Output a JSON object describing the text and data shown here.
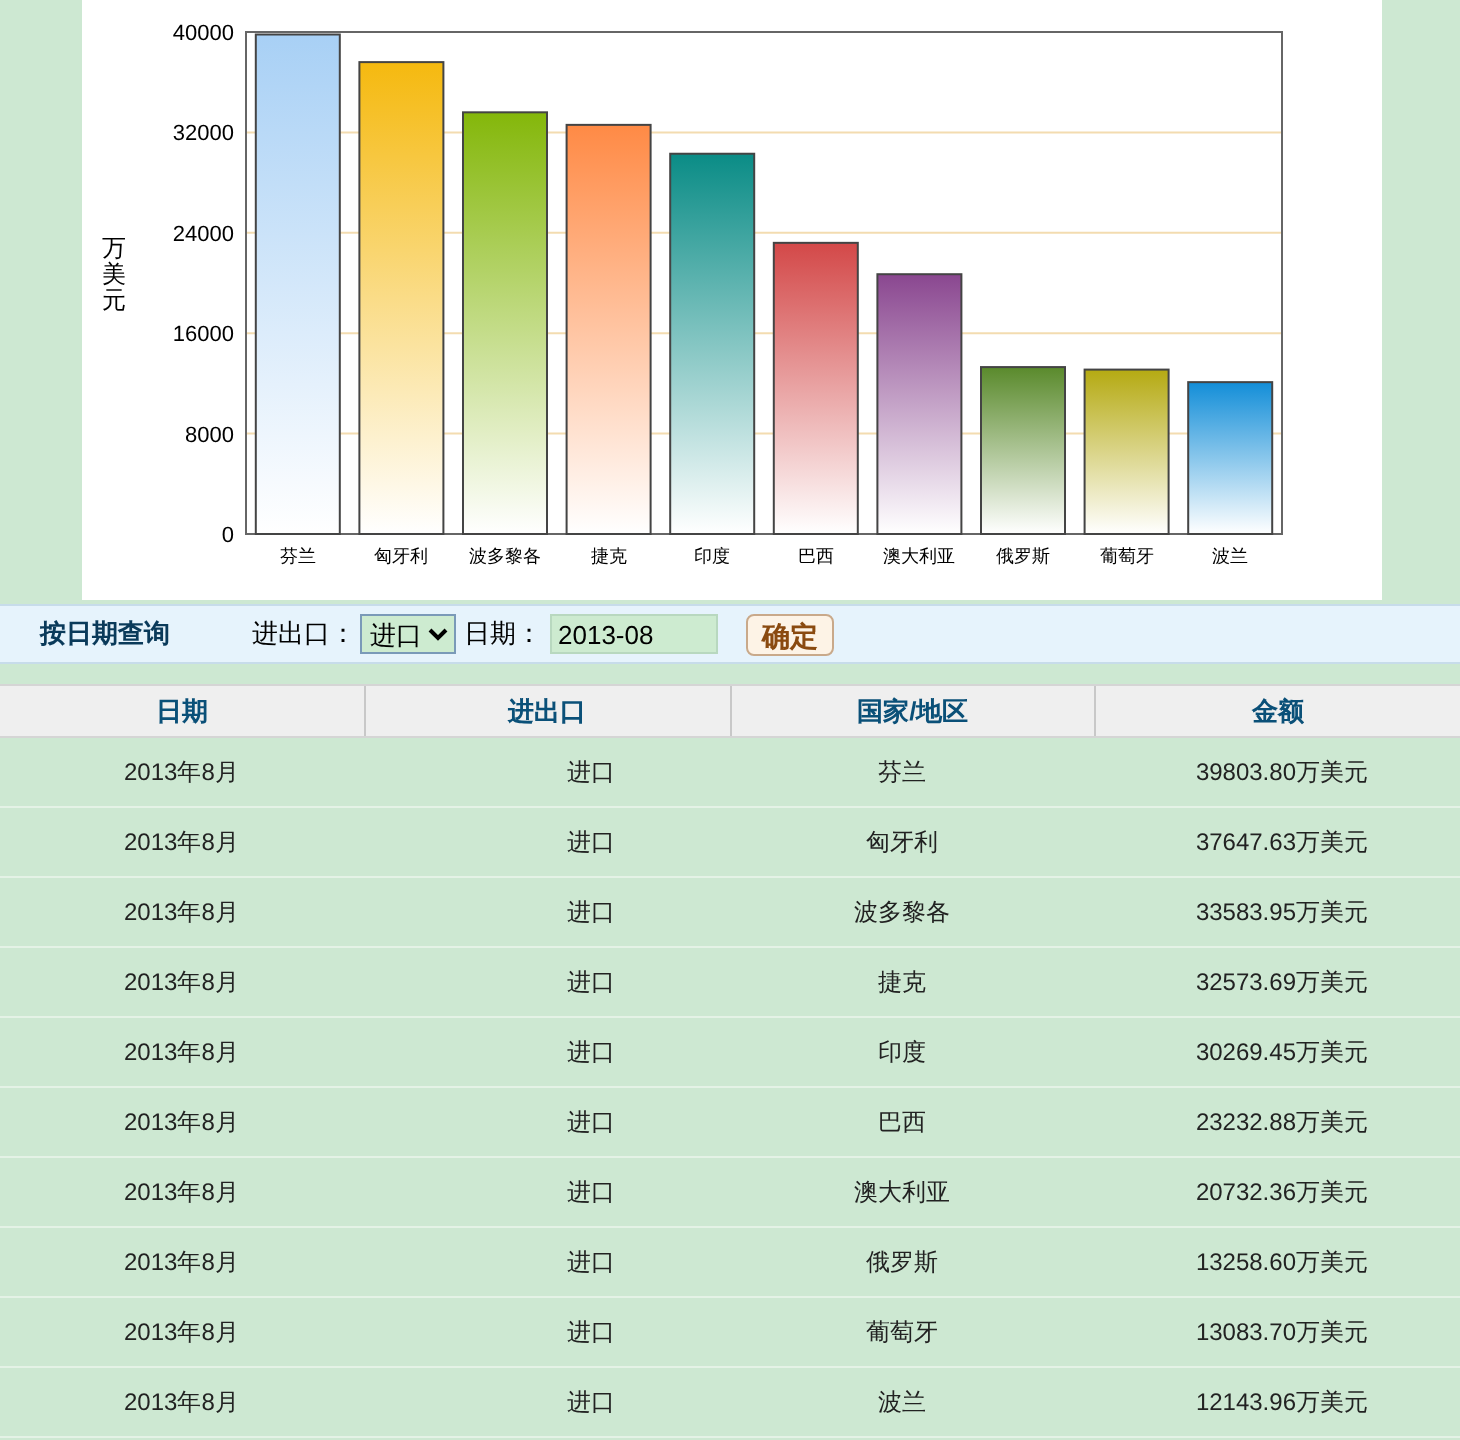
{
  "chart_data": {
    "type": "bar",
    "ylabel": "万美元",
    "categories": [
      "芬兰",
      "匈牙利",
      "波多黎各",
      "捷克",
      "印度",
      "巴西",
      "澳大利亚",
      "俄罗斯",
      "葡萄牙",
      "波兰"
    ],
    "series": [
      {
        "values": [
          39800,
          37600,
          33600,
          32600,
          30300,
          23200,
          20700,
          13300,
          13100,
          12100
        ]
      }
    ],
    "grid": true,
    "colors": [
      "#a8d0f5",
      "#f5b90f",
      "#84b70a",
      "#ff8a45",
      "#0a8c86",
      "#d34848",
      "#8a4790",
      "#5a8a2c",
      "#b5aa12",
      "#138ed8"
    ],
    "ylim": [
      0,
      40000
    ],
    "yticks": [
      0,
      8000,
      16000,
      24000,
      32000,
      40000
    ]
  },
  "filter": {
    "title": "按日期查询",
    "type_label": "进出口：",
    "type_value": "进口",
    "date_label": "日期：",
    "date_value": "2013-08",
    "submit": "确定"
  },
  "table": {
    "columns": [
      "日期",
      "进出口",
      "国家/地区",
      "金额"
    ],
    "rows": [
      [
        "2013年8月",
        "进口",
        "芬兰",
        "39803.80万美元"
      ],
      [
        "2013年8月",
        "进口",
        "匈牙利",
        "37647.63万美元"
      ],
      [
        "2013年8月",
        "进口",
        "波多黎各",
        "33583.95万美元"
      ],
      [
        "2013年8月",
        "进口",
        "捷克",
        "32573.69万美元"
      ],
      [
        "2013年8月",
        "进口",
        "印度",
        "30269.45万美元"
      ],
      [
        "2013年8月",
        "进口",
        "巴西",
        "23232.88万美元"
      ],
      [
        "2013年8月",
        "进口",
        "澳大利亚",
        "20732.36万美元"
      ],
      [
        "2013年8月",
        "进口",
        "俄罗斯",
        "13258.60万美元"
      ],
      [
        "2013年8月",
        "进口",
        "葡萄牙",
        "13083.70万美元"
      ],
      [
        "2013年8月",
        "进口",
        "波兰",
        "12143.96万美元"
      ]
    ]
  }
}
